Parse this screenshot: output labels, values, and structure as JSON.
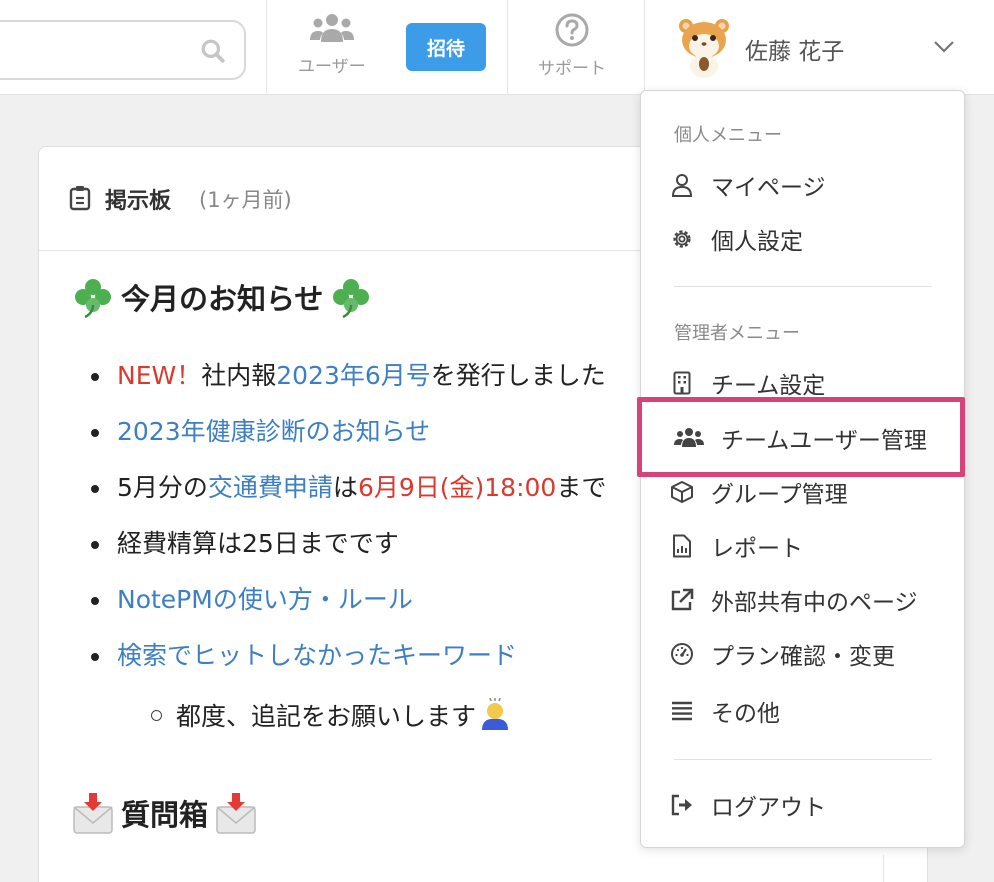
{
  "header": {
    "users_label": "ユーザー",
    "invite_label": "招待",
    "support_label": "サポート",
    "user_name": "佐藤 花子"
  },
  "card": {
    "title": "掲示板",
    "time": "(1ヶ月前)",
    "section1_title": "今月のお知らせ",
    "section2_title": "質問箱",
    "items": {
      "i1_new": "NEW！",
      "i1_text": "社内報",
      "i1_link": "2023年6月号",
      "i1_rest": "を発行しました",
      "i2_link": "2023年健康診断のお知らせ",
      "i3_a": "5月分の",
      "i3_link": "交通費申請",
      "i3_b": "は",
      "i3_date": "6月9日(金)18:00",
      "i3_c": "まで",
      "i4": "経費精算は25日までです",
      "i5_link": "NotePMの使い方・ルール",
      "i6_link": "検索でヒットしなかったキーワード",
      "sub": "都度、追記をお願いします"
    }
  },
  "menu": {
    "personal_header": "個人メニュー",
    "mypage": "マイページ",
    "personal_settings": "個人設定",
    "admin_header": "管理者メニュー",
    "team_settings": "チーム設定",
    "team_users": "チームユーザー管理",
    "group_mgmt": "グループ管理",
    "report": "レポート",
    "external_share": "外部共有中のページ",
    "plan": "プラン確認・変更",
    "other": "その他",
    "logout": "ログアウト"
  },
  "colors": {
    "accent": "#3c9ce8",
    "link": "#3d7fc4",
    "alert": "#d93a2e",
    "highlight": "#d6437b"
  }
}
